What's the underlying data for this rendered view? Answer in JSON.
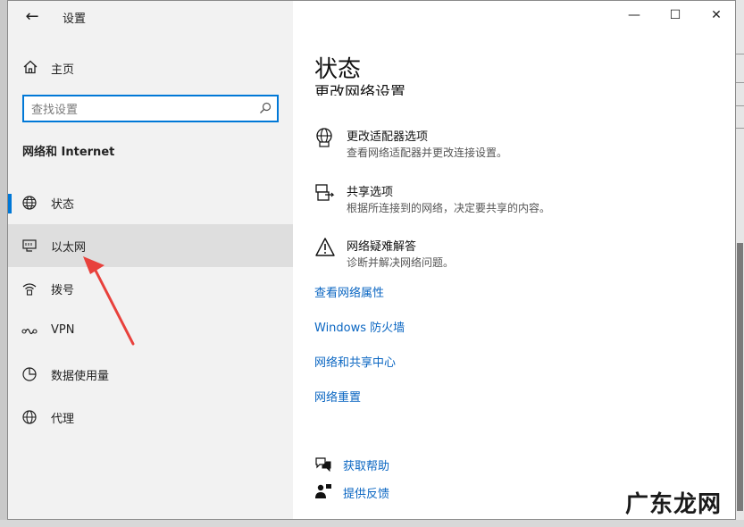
{
  "window": {
    "title": "设置",
    "back_glyph": "←",
    "minimize_glyph": "—",
    "maximize_glyph": "☐",
    "close_glyph": "✕"
  },
  "sidebar": {
    "home_label": "主页",
    "search_placeholder": "查找设置",
    "section_title": "网络和 Internet",
    "items": [
      {
        "label": "状态",
        "icon": "globe-icon",
        "active": true
      },
      {
        "label": "以太网",
        "icon": "ethernet-icon",
        "hovered": true
      },
      {
        "label": "拨号",
        "icon": "dialup-icon"
      },
      {
        "label": "VPN",
        "icon": "vpn-icon"
      },
      {
        "label": "数据使用量",
        "icon": "data-usage-icon"
      },
      {
        "label": "代理",
        "icon": "proxy-globe-icon"
      }
    ]
  },
  "main": {
    "title": "状态",
    "partial_heading": "更改网络设置",
    "options": [
      {
        "title": "更改适配器选项",
        "desc": "查看网络适配器并更改连接设置。",
        "icon": "adapter-globe-icon"
      },
      {
        "title": "共享选项",
        "desc": "根据所连接到的网络，决定要共享的内容。",
        "icon": "sharing-icon"
      },
      {
        "title": "网络疑难解答",
        "desc": "诊断并解决网络问题。",
        "icon": "warning-icon"
      }
    ],
    "links": [
      "查看网络属性",
      "Windows 防火墙",
      "网络和共享中心",
      "网络重置"
    ],
    "help": [
      {
        "label": "获取帮助",
        "icon": "help-chat-icon"
      },
      {
        "label": "提供反馈",
        "icon": "feedback-icon"
      }
    ]
  },
  "watermark": "广东龙网",
  "colors": {
    "accent": "#0078d7",
    "link": "#0a66c2",
    "arrow": "#e8413c",
    "sidebar_bg": "#f2f2f2"
  }
}
